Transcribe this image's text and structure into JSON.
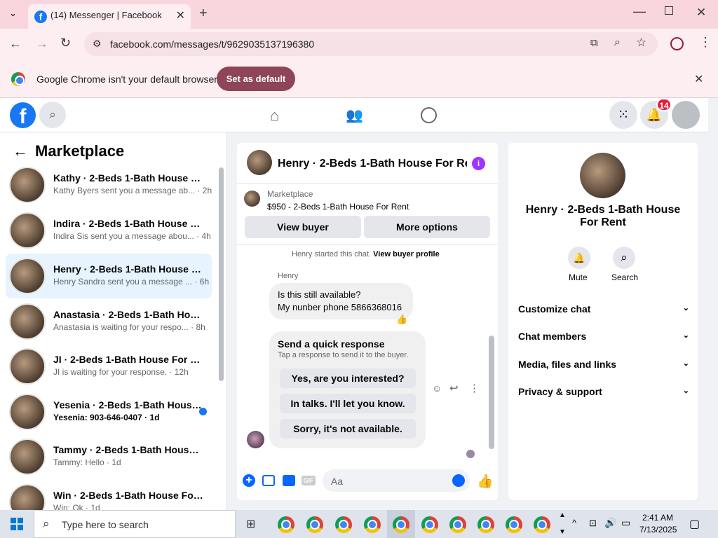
{
  "browser": {
    "tab_title": "(14) Messenger | Facebook",
    "url": "facebook.com/messages/t/9629035137196380",
    "infobar_text": "Google Chrome isn't your default browser",
    "infobar_button": "Set as default"
  },
  "fb_header": {
    "notification_count": "14"
  },
  "sidebar": {
    "title": "Marketplace",
    "conversations": [
      {
        "name": "Kathy · 2-Beds 1-Bath House For...",
        "preview": "Kathy Byers sent you a message ab...",
        "time": "2h",
        "selected": false,
        "unread": false
      },
      {
        "name": "Indira · 2-Beds 1-Bath House For...",
        "preview": "Indira Sis sent you a message abou...",
        "time": "4h",
        "selected": false,
        "unread": false
      },
      {
        "name": "Henry · 2-Beds 1-Bath House Fo...",
        "preview": "Henry Sandra sent you a message ...",
        "time": "6h",
        "selected": true,
        "unread": false
      },
      {
        "name": "Anastasia · 2-Beds 1-Bath House...",
        "preview": "Anastasia is waiting for your respo...",
        "time": "8h",
        "selected": false,
        "unread": false
      },
      {
        "name": "JI · 2-Beds 1-Bath House For Rent",
        "preview": "JI is waiting for your response.",
        "time": "12h",
        "selected": false,
        "unread": false
      },
      {
        "name": "Yesenia · 2-Beds 1-Bath House...",
        "preview": "Yesenia: 903-646-0407",
        "time": "1d",
        "selected": false,
        "unread": true
      },
      {
        "name": "Tammy · 2-Beds 1-Bath House F...",
        "preview": "Tammy: Hello",
        "time": "1d",
        "selected": false,
        "unread": false
      },
      {
        "name": "Win · 2-Beds 1-Bath House For ...",
        "preview": "Win: Ok",
        "time": "1d",
        "selected": false,
        "unread": false
      }
    ]
  },
  "chat": {
    "title": "Henry · 2-Beds 1-Bath House For Re...",
    "listing_label": "Marketplace",
    "listing_price_title": "$950 - 2-Beds 1-Bath House For Rent",
    "view_buyer": "View buyer",
    "more_options": "More options",
    "started_text": "Henry started this chat.",
    "view_buyer_profile": "View buyer profile",
    "sender": "Henry",
    "message_line1": "Is this still available?",
    "message_line2": "My nunber phone 5866368016",
    "quick_title": "Send a quick response",
    "quick_subtitle": "Tap a response to send it to the buyer.",
    "quick_responses": [
      "Yes, are you interested?",
      "In talks. I'll let you know.",
      "Sorry, it's not available."
    ],
    "composer_placeholder": "Aa"
  },
  "details": {
    "title": "Henry · 2-Beds 1-Bath House For Rent",
    "mute": "Mute",
    "search": "Search",
    "sections": [
      "Customize chat",
      "Chat members",
      "Media, files and links",
      "Privacy & support"
    ]
  },
  "taskbar": {
    "search_placeholder": "Type here to search",
    "time": "2:41 AM",
    "date": "7/13/2025"
  }
}
